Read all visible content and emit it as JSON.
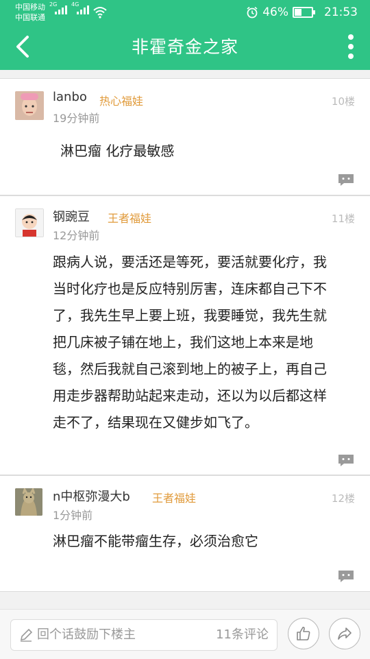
{
  "status_bar": {
    "carrier_1": "中国移动",
    "carrier_2": "中国联通",
    "net_1": "2G",
    "net_2": "4G",
    "battery_percent": "46%",
    "battery_level": 0.46,
    "time": "21:53"
  },
  "header": {
    "title": "非霍奇金之家",
    "back_icon": "chevron-left-icon",
    "more_icon": "more-vertical-icon"
  },
  "posts": [
    {
      "username": "lanbo",
      "badge": "热心福娃",
      "time": "19分钟前",
      "floor": "10楼",
      "content": "淋巴瘤 化疗最敏感"
    },
    {
      "username": "钢豌豆",
      "badge": "王者福娃",
      "time": "12分钟前",
      "floor": "11楼",
      "content": "跟病人说，要活还是等死，要活就要化疗，我当时化疗也是反应特别厉害，连床都自己下不了，我先生早上要上班，我要睡觉，我先生就把几床被子铺在地上，我们这地上本来是地毯，然后我就自己滚到地上的被子上，再自己用走步器帮助站起来走动，还以为以后都这样走不了，结果现在又健步如飞了。"
    },
    {
      "username": "n中枢弥漫大b",
      "badge": "王者福娃",
      "time": "1分钟前",
      "floor": "12楼",
      "content": "淋巴瘤不能带瘤生存，必须治愈它"
    }
  ],
  "bottom_bar": {
    "placeholder": "回个话鼓励下楼主",
    "comment_count": "11条评论",
    "like_icon": "thumbs-up-icon",
    "share_icon": "share-icon"
  },
  "colors": {
    "brand_green": "#2fc486",
    "badge_orange": "#e09a3a"
  }
}
